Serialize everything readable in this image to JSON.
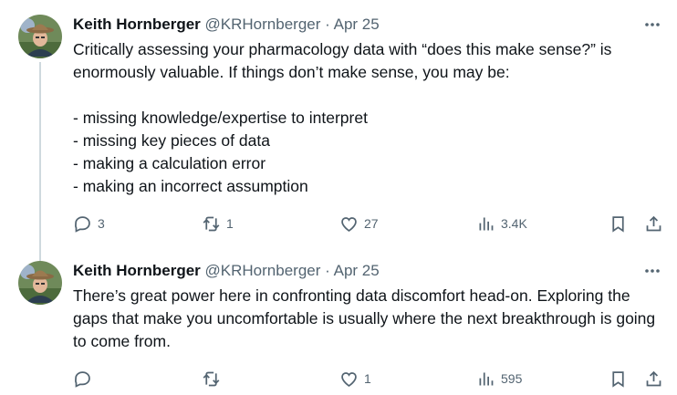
{
  "tweets": [
    {
      "author": {
        "name": "Keith Hornberger",
        "handle": "@KRHornberger",
        "separator": "·",
        "date": "Apr 25"
      },
      "text": "Critically assessing your pharmacology data with “does this make sense?” is enormously valuable. If things don’t make sense, you may be:\n\n- missing knowledge/expertise to interpret\n- missing key pieces of data\n- making a calculation error\n- making an incorrect assumption",
      "actions": {
        "replies": "3",
        "retweets": "1",
        "likes": "27",
        "views": "3.4K"
      }
    },
    {
      "author": {
        "name": "Keith Hornberger",
        "handle": "@KRHornberger",
        "separator": "·",
        "date": "Apr 25"
      },
      "text": "There’s great power here in confronting data discomfort head-on. Exploring the gaps that make you uncomfortable is usually where the next breakthrough is going to come from.",
      "actions": {
        "replies": "",
        "retweets": "",
        "likes": "1",
        "views": "595"
      }
    }
  ],
  "icons": {
    "reply": "reply-icon",
    "retweet": "retweet-icon",
    "like": "heart-icon",
    "views": "analytics-icon",
    "bookmark": "bookmark-icon",
    "share": "share-icon",
    "more": "more-icon"
  },
  "colors": {
    "text": "#0f1419",
    "secondary": "#536471",
    "thread_line": "#cfd9de"
  }
}
